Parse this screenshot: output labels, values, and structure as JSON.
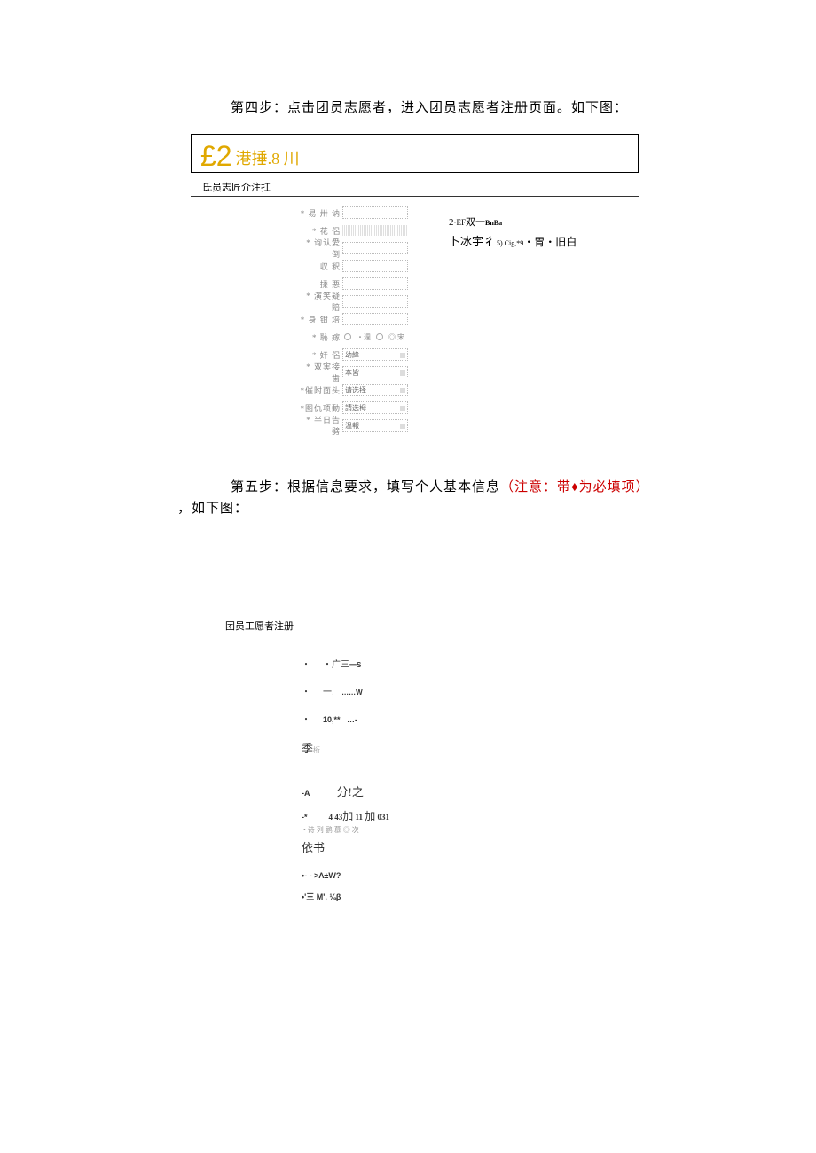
{
  "step4": {
    "text": "第四步：点击团员志愿者，进入团员志愿者注册页面。如下图："
  },
  "header": {
    "symbol": "£2",
    "cn": " 港捶.8 川"
  },
  "section1": {
    "title": "氏员志匠介注扛"
  },
  "form1": {
    "rows": [
      {
        "label": "* 易 卅 讷",
        "type": "input"
      },
      {
        "label": "* 花    侶",
        "type": "filled"
      },
      {
        "label": "* 询认愛倒",
        "type": "input"
      },
      {
        "label": "  収    釈",
        "type": "input"
      },
      {
        "label": "  揉    悪",
        "type": "input"
      },
      {
        "label": "* 演笑疑賠",
        "type": "input"
      },
      {
        "label": "* 身 钳 培",
        "type": "input"
      },
      {
        "label": "* 恥    嫁",
        "type": "radio",
        "opts": [
          "・週",
          "◎ 宋"
        ]
      },
      {
        "label": "* 奸    侶",
        "type": "select",
        "value": "幼緯"
      },
      {
        "label": "* 双実接歯",
        "type": "select",
        "value": "本皆"
      },
      {
        "label": "*催附面头",
        "type": "select",
        "value": "请选择"
      },
      {
        "label": "*图仇项動",
        "type": "select",
        "value": "請选栂"
      },
      {
        "label": "* 半日告劈",
        "type": "select",
        "value": "温報"
      }
    ]
  },
  "sidenotes": {
    "line1_a": "2",
    "line1_b": "·EF",
    "line1_c": "双一",
    "line1_d": "BnBa",
    "line2_a": "卜冰宇彳",
    "line2_b": " 5) Cig,*9",
    "line2_c": "・胃・旧白"
  },
  "step5": {
    "prefix": "第五步：根据信息要求，填写个人基本信息",
    "note": "（注意：带♦为必填项）",
    "suffix": "，如下图："
  },
  "section2": {
    "title": "团员工愿者注册"
  },
  "form2": {
    "r1": "・广三",
    "r1s": "一S",
    "r2a": "一,",
    "r2b": "……W",
    "r3a": "10,**",
    "r3b": "…-",
    "r4": "季",
    "r4s": "桁",
    "r5a": "-A",
    "r5b": "分!之",
    "r6a": "-*",
    "r6b": "4  43",
    "r6c": "加",
    "r6d": " 11 ",
    "r6e": "加",
    "r6f": " 031",
    "r6sub": "• 诗     列  鹂 慕     ◎ 次",
    "r7": "依书",
    "r8": "•- - >Λ±W?",
    "r9": "•'三 M',   ⅛β"
  }
}
